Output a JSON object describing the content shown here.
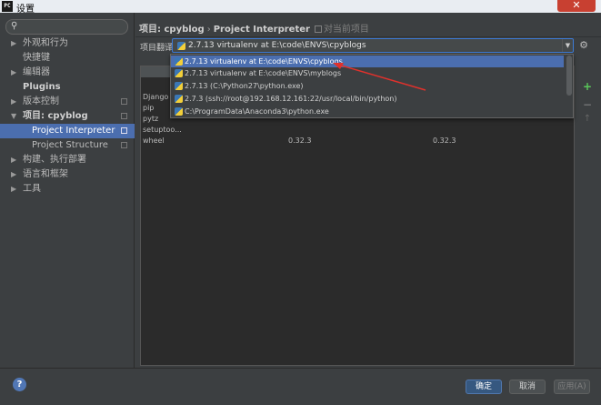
{
  "window": {
    "title": "设置",
    "app_icon": "PC",
    "close_label": "✕"
  },
  "sidebar": {
    "search_placeholder": "",
    "items": [
      {
        "label": "外观和行为",
        "arrow": "▶"
      },
      {
        "label": "快捷键"
      },
      {
        "label": "编辑器",
        "arrow": "▶"
      },
      {
        "label": "Plugins"
      },
      {
        "label": "版本控制",
        "arrow": "▶"
      },
      {
        "label": "项目: cpyblog",
        "arrow": "▼"
      },
      {
        "label": "Project Interpreter"
      },
      {
        "label": "Project Structure"
      },
      {
        "label": "构建、执行部署",
        "arrow": "▶"
      },
      {
        "label": "语言和框架",
        "arrow": "▶"
      },
      {
        "label": "工具",
        "arrow": "▶"
      }
    ]
  },
  "breadcrumb": {
    "project": "项目: cpyblog",
    "sep": "›",
    "page": "Project Interpreter",
    "note": "对当前项目"
  },
  "interpreter": {
    "label": "项目翻译:",
    "selected": "2.7.13 virtualenv at E:\\code\\ENVS\\cpyblogs"
  },
  "dropdown_options": [
    "2.7.13 virtualenv at E:\\code\\ENVS\\cpyblogs",
    "2.7.13 virtualenv at E:\\code\\ENVS\\myblogs",
    "2.7.13 (C:\\Python27\\python.exe)",
    "2.7.3 (ssh://root@192.168.12.161:22/usr/local/bin/python)",
    "C:\\ProgramData\\Anaconda3\\python.exe"
  ],
  "packages": [
    {
      "name": "Django",
      "version": "",
      "latest": ""
    },
    {
      "name": "pip",
      "version": "",
      "latest": ""
    },
    {
      "name": "pytz",
      "version": "",
      "latest": ""
    },
    {
      "name": "setuptoo...",
      "version": "",
      "latest": ""
    },
    {
      "name": "wheel",
      "version": "0.32.3",
      "latest": "0.32.3"
    }
  ],
  "tools": {
    "add": "+",
    "remove": "−",
    "up": "↑"
  },
  "buttons": {
    "ok": "确定",
    "cancel": "取消",
    "apply": "应用(A)",
    "help": "?"
  },
  "colors": {
    "selection": "#4b6eaf",
    "annotation_arrow": "#e0312c",
    "background": "#3c3f41"
  }
}
